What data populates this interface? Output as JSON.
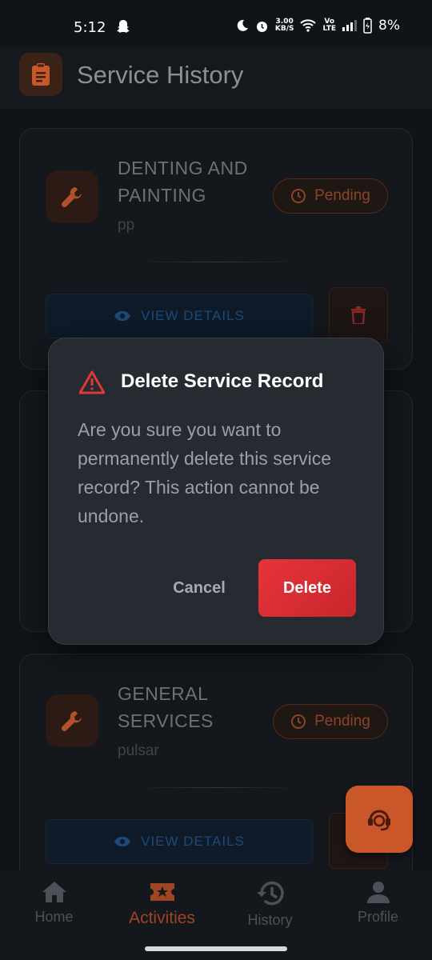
{
  "status_bar": {
    "time": "5:12",
    "net_speed_value": "3.00",
    "net_speed_unit": "KB/S",
    "volte_top": "Vo",
    "volte_bottom": "LTE",
    "battery": "8%"
  },
  "app_bar": {
    "title": "Service History",
    "icon": "clipboard-icon"
  },
  "cards": [
    {
      "title_line1": "DENTING AND",
      "title_line2": "PAINTING",
      "subtitle": "pp",
      "status": "Pending",
      "view_label": "VIEW DETAILS"
    },
    {
      "title_line1": "GENERAL",
      "title_line2": "SERVICES",
      "subtitle": "pulsar",
      "status": "Pending",
      "view_label": "VIEW DETAILS"
    }
  ],
  "dialog": {
    "title": "Delete Service Record",
    "message": "Are you sure you want to permanently delete this service record? This action cannot be undone.",
    "cancel_label": "Cancel",
    "delete_label": "Delete"
  },
  "bottom_nav": {
    "items": [
      {
        "label": "Home",
        "icon": "home-icon"
      },
      {
        "label": "Activities",
        "icon": "ticket-icon"
      },
      {
        "label": "History",
        "icon": "history-icon"
      },
      {
        "label": "Profile",
        "icon": "person-icon"
      }
    ],
    "active": "Activities"
  },
  "colors": {
    "accent": "#c9572a",
    "danger": "#e6343a",
    "info": "#1d4a7a"
  }
}
